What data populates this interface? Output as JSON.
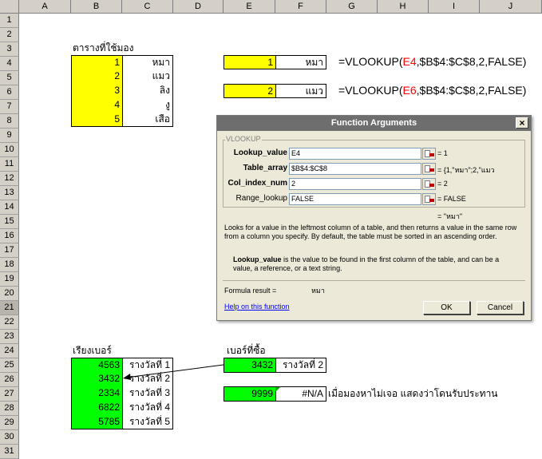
{
  "columns": [
    "A",
    "B",
    "C",
    "D",
    "E",
    "F",
    "G",
    "H",
    "I",
    "J"
  ],
  "rows": [
    "1",
    "2",
    "3",
    "4",
    "5",
    "6",
    "7",
    "8",
    "9",
    "10",
    "11",
    "12",
    "13",
    "14",
    "15",
    "16",
    "17",
    "18",
    "19",
    "20",
    "21",
    "22",
    "23",
    "24",
    "25",
    "26",
    "27",
    "28",
    "29",
    "30",
    "31"
  ],
  "selected_row": "21",
  "table1": {
    "title": "ตารางที่ใช้มอง",
    "nums": [
      "1",
      "2",
      "3",
      "4",
      "5"
    ],
    "names": [
      "หมา",
      "แมว",
      "ลิง",
      "งู",
      "เสือ"
    ]
  },
  "lookup1": {
    "value": "1",
    "result": "หมา",
    "formula_prefix": "=VLOOKUP(",
    "ref": "E4",
    "formula_suffix": ",$B$4:$C$8,2,FALSE)"
  },
  "lookup2": {
    "value": "2",
    "result": "แมว",
    "formula_prefix": "=VLOOKUP(",
    "ref": "E6",
    "formula_suffix": ",$B$4:$C$8,2,FALSE)"
  },
  "dialog": {
    "title": "Function Arguments",
    "close": "×",
    "group": "VLOOKUP",
    "args": [
      {
        "label": "Lookup_value",
        "value": "E4",
        "result": "= 1",
        "bold": true
      },
      {
        "label": "Table_array",
        "value": "$B$4:$C$8",
        "result": "= {1,\"หมา\";2,\"แมว",
        "bold": true
      },
      {
        "label": "Col_index_num",
        "value": "2",
        "result": "= 2",
        "bold": true
      },
      {
        "label": "Range_lookup",
        "value": "FALSE",
        "result": "= FALSE",
        "bold": false
      }
    ],
    "final_result": "= \"หมา\"",
    "description": "Looks for a value in the leftmost column of a table, and then returns a value in the same row from a column you specify. By default, the table must be sorted in an ascending order.",
    "arg_help_name": "Lookup_value",
    "arg_help_text": " is the value to be found in the first column of the table, and can be a value, a reference, or a text string.",
    "formula_result_label": "Formula result =",
    "formula_result_value": "หมา",
    "help_link": "Help on this function",
    "ok": "OK",
    "cancel": "Cancel"
  },
  "table2": {
    "title": "เรียงเบอร์",
    "nums": [
      "4563",
      "3432",
      "2334",
      "6822",
      "5785"
    ],
    "prizes": [
      "รางวัลที่ 1",
      "รางวัลที่ 2",
      "รางวัลที่ 3",
      "รางวัลที่ 4",
      "รางวัลที่ 5"
    ]
  },
  "purchase": {
    "title": "เบอร์ที่ซื้อ",
    "num1": "3432",
    "result1": "รางวัลที่ 2",
    "num2": "9999",
    "result2": "#N/A",
    "note": "เมื่อมองหาไม่เจอ แสดงว่าโดนรับประทาน"
  },
  "colors": {
    "yellow": "#ffff00",
    "green": "#00ff00",
    "ref_red": "#ff0000",
    "link_blue": "#0000ff"
  }
}
